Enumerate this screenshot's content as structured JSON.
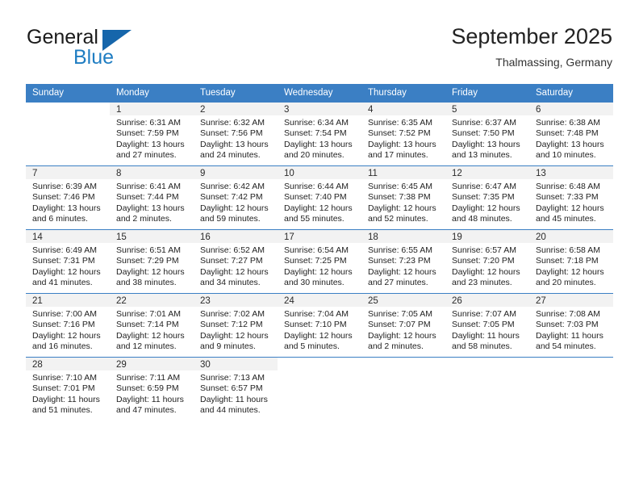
{
  "brand": {
    "name_top": "General",
    "name_bottom": "Blue",
    "accent_color": "#1666ab",
    "blue_text_color": "#1f7dc2"
  },
  "header": {
    "title": "September 2025",
    "location": "Thalmassing, Germany"
  },
  "theme": {
    "header_bar_color": "#3b7fc4",
    "daynum_bg": "#f2f2f2"
  },
  "weekday_headers": [
    "Sunday",
    "Monday",
    "Tuesday",
    "Wednesday",
    "Thursday",
    "Friday",
    "Saturday"
  ],
  "weeks": [
    [
      {
        "day": "",
        "blank": true,
        "lines": []
      },
      {
        "day": "1",
        "lines": [
          "Sunrise: 6:31 AM",
          "Sunset: 7:59 PM",
          "Daylight: 13 hours",
          "and 27 minutes."
        ]
      },
      {
        "day": "2",
        "lines": [
          "Sunrise: 6:32 AM",
          "Sunset: 7:56 PM",
          "Daylight: 13 hours",
          "and 24 minutes."
        ]
      },
      {
        "day": "3",
        "lines": [
          "Sunrise: 6:34 AM",
          "Sunset: 7:54 PM",
          "Daylight: 13 hours",
          "and 20 minutes."
        ]
      },
      {
        "day": "4",
        "lines": [
          "Sunrise: 6:35 AM",
          "Sunset: 7:52 PM",
          "Daylight: 13 hours",
          "and 17 minutes."
        ]
      },
      {
        "day": "5",
        "lines": [
          "Sunrise: 6:37 AM",
          "Sunset: 7:50 PM",
          "Daylight: 13 hours",
          "and 13 minutes."
        ]
      },
      {
        "day": "6",
        "lines": [
          "Sunrise: 6:38 AM",
          "Sunset: 7:48 PM",
          "Daylight: 13 hours",
          "and 10 minutes."
        ]
      }
    ],
    [
      {
        "day": "7",
        "lines": [
          "Sunrise: 6:39 AM",
          "Sunset: 7:46 PM",
          "Daylight: 13 hours",
          "and 6 minutes."
        ]
      },
      {
        "day": "8",
        "lines": [
          "Sunrise: 6:41 AM",
          "Sunset: 7:44 PM",
          "Daylight: 13 hours",
          "and 2 minutes."
        ]
      },
      {
        "day": "9",
        "lines": [
          "Sunrise: 6:42 AM",
          "Sunset: 7:42 PM",
          "Daylight: 12 hours",
          "and 59 minutes."
        ]
      },
      {
        "day": "10",
        "lines": [
          "Sunrise: 6:44 AM",
          "Sunset: 7:40 PM",
          "Daylight: 12 hours",
          "and 55 minutes."
        ]
      },
      {
        "day": "11",
        "lines": [
          "Sunrise: 6:45 AM",
          "Sunset: 7:38 PM",
          "Daylight: 12 hours",
          "and 52 minutes."
        ]
      },
      {
        "day": "12",
        "lines": [
          "Sunrise: 6:47 AM",
          "Sunset: 7:35 PM",
          "Daylight: 12 hours",
          "and 48 minutes."
        ]
      },
      {
        "day": "13",
        "lines": [
          "Sunrise: 6:48 AM",
          "Sunset: 7:33 PM",
          "Daylight: 12 hours",
          "and 45 minutes."
        ]
      }
    ],
    [
      {
        "day": "14",
        "lines": [
          "Sunrise: 6:49 AM",
          "Sunset: 7:31 PM",
          "Daylight: 12 hours",
          "and 41 minutes."
        ]
      },
      {
        "day": "15",
        "lines": [
          "Sunrise: 6:51 AM",
          "Sunset: 7:29 PM",
          "Daylight: 12 hours",
          "and 38 minutes."
        ]
      },
      {
        "day": "16",
        "lines": [
          "Sunrise: 6:52 AM",
          "Sunset: 7:27 PM",
          "Daylight: 12 hours",
          "and 34 minutes."
        ]
      },
      {
        "day": "17",
        "lines": [
          "Sunrise: 6:54 AM",
          "Sunset: 7:25 PM",
          "Daylight: 12 hours",
          "and 30 minutes."
        ]
      },
      {
        "day": "18",
        "lines": [
          "Sunrise: 6:55 AM",
          "Sunset: 7:23 PM",
          "Daylight: 12 hours",
          "and 27 minutes."
        ]
      },
      {
        "day": "19",
        "lines": [
          "Sunrise: 6:57 AM",
          "Sunset: 7:20 PM",
          "Daylight: 12 hours",
          "and 23 minutes."
        ]
      },
      {
        "day": "20",
        "lines": [
          "Sunrise: 6:58 AM",
          "Sunset: 7:18 PM",
          "Daylight: 12 hours",
          "and 20 minutes."
        ]
      }
    ],
    [
      {
        "day": "21",
        "lines": [
          "Sunrise: 7:00 AM",
          "Sunset: 7:16 PM",
          "Daylight: 12 hours",
          "and 16 minutes."
        ]
      },
      {
        "day": "22",
        "lines": [
          "Sunrise: 7:01 AM",
          "Sunset: 7:14 PM",
          "Daylight: 12 hours",
          "and 12 minutes."
        ]
      },
      {
        "day": "23",
        "lines": [
          "Sunrise: 7:02 AM",
          "Sunset: 7:12 PM",
          "Daylight: 12 hours",
          "and 9 minutes."
        ]
      },
      {
        "day": "24",
        "lines": [
          "Sunrise: 7:04 AM",
          "Sunset: 7:10 PM",
          "Daylight: 12 hours",
          "and 5 minutes."
        ]
      },
      {
        "day": "25",
        "lines": [
          "Sunrise: 7:05 AM",
          "Sunset: 7:07 PM",
          "Daylight: 12 hours",
          "and 2 minutes."
        ]
      },
      {
        "day": "26",
        "lines": [
          "Sunrise: 7:07 AM",
          "Sunset: 7:05 PM",
          "Daylight: 11 hours",
          "and 58 minutes."
        ]
      },
      {
        "day": "27",
        "lines": [
          "Sunrise: 7:08 AM",
          "Sunset: 7:03 PM",
          "Daylight: 11 hours",
          "and 54 minutes."
        ]
      }
    ],
    [
      {
        "day": "28",
        "lines": [
          "Sunrise: 7:10 AM",
          "Sunset: 7:01 PM",
          "Daylight: 11 hours",
          "and 51 minutes."
        ]
      },
      {
        "day": "29",
        "lines": [
          "Sunrise: 7:11 AM",
          "Sunset: 6:59 PM",
          "Daylight: 11 hours",
          "and 47 minutes."
        ]
      },
      {
        "day": "30",
        "lines": [
          "Sunrise: 7:13 AM",
          "Sunset: 6:57 PM",
          "Daylight: 11 hours",
          "and 44 minutes."
        ]
      },
      {
        "day": "",
        "blank": true,
        "lines": []
      },
      {
        "day": "",
        "blank": true,
        "lines": []
      },
      {
        "day": "",
        "blank": true,
        "lines": []
      },
      {
        "day": "",
        "blank": true,
        "lines": []
      }
    ]
  ]
}
